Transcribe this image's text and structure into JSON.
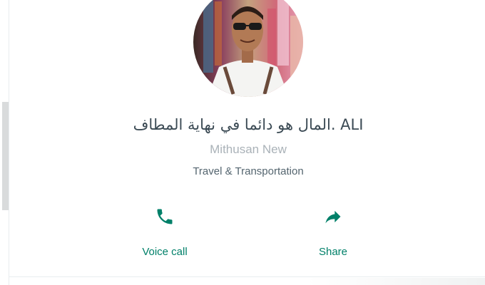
{
  "contact": {
    "name": "المال هو دائما في نهاية المطاف. ALI",
    "subname": "Mithusan New",
    "category": "Travel & Transportation",
    "avatar_icon": "profile-photo"
  },
  "actions": [
    {
      "label": "Voice call",
      "icon": "phone-icon"
    },
    {
      "label": "Share",
      "icon": "share-arrow-icon"
    }
  ],
  "colors": {
    "accent": "#008069",
    "name_text": "#3b4a54",
    "subname_text": "#aab2b8",
    "category_text": "#54656f"
  }
}
